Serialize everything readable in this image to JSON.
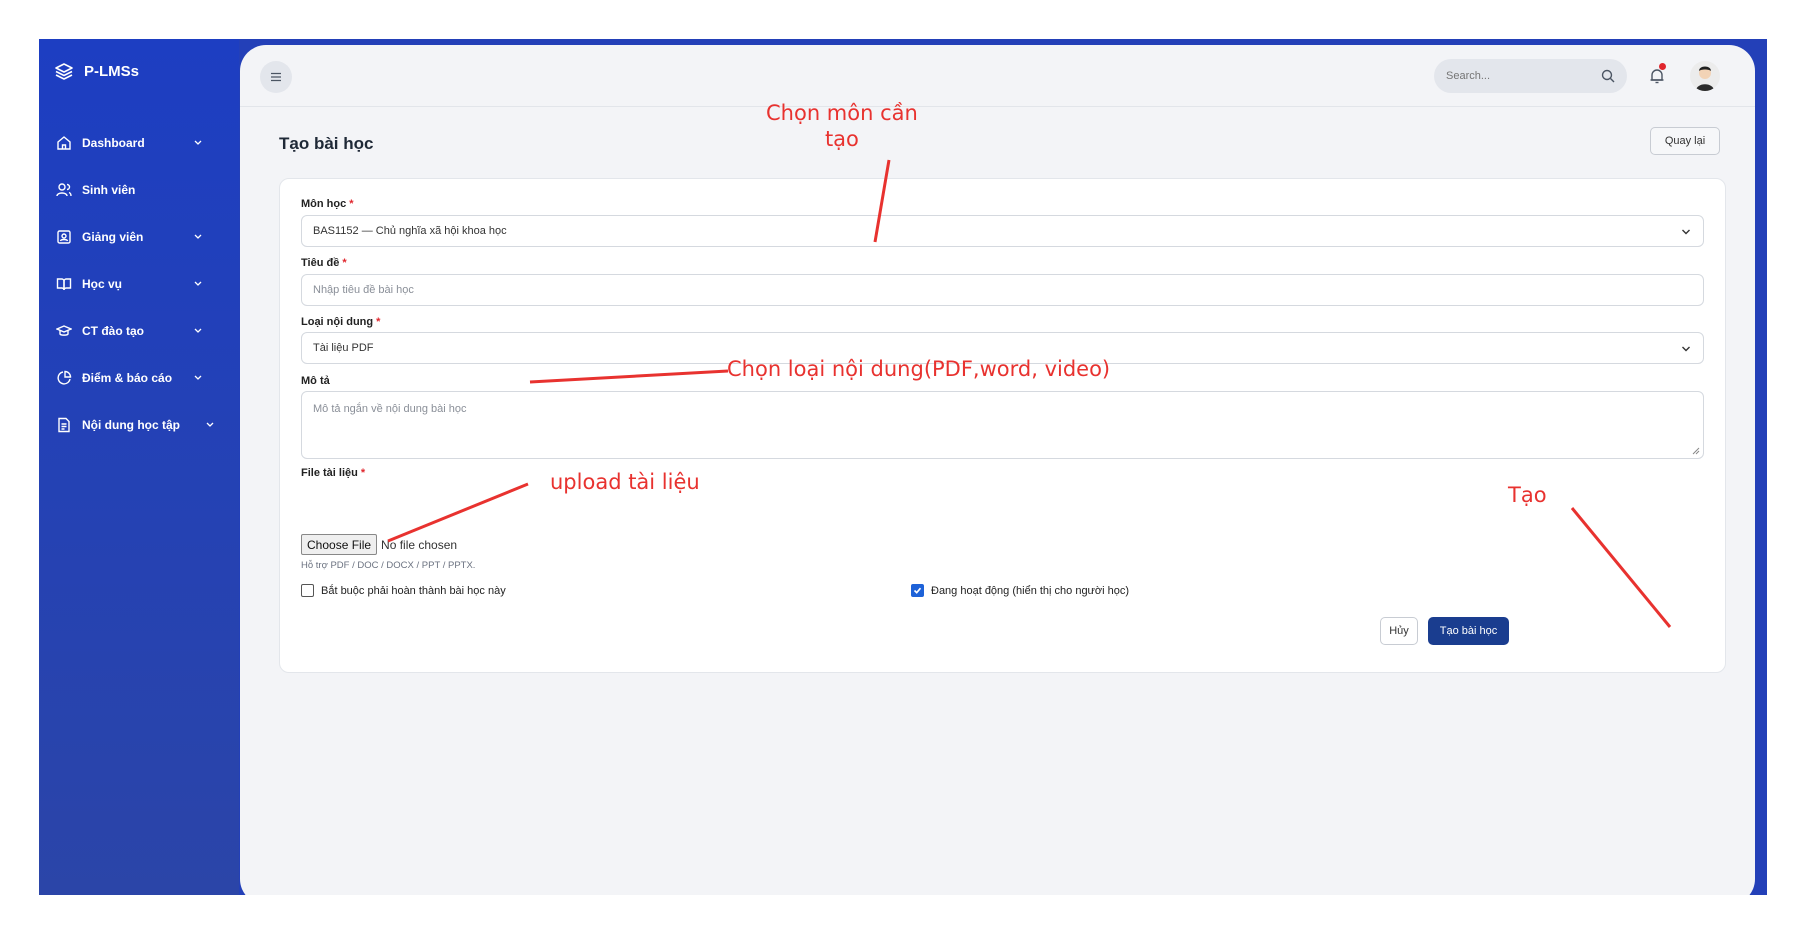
{
  "app": {
    "brand": "P-LMSs"
  },
  "sidebar": {
    "items": [
      {
        "label": "Dashboard",
        "icon": "home-icon",
        "has_chevron": true
      },
      {
        "label": "Sinh viên",
        "icon": "users-icon",
        "has_chevron": false
      },
      {
        "label": "Giảng viên",
        "icon": "id-card-icon",
        "has_chevron": true
      },
      {
        "label": "Học vụ",
        "icon": "book-icon",
        "has_chevron": true
      },
      {
        "label": "CT đào tạo",
        "icon": "graduation-cap-icon",
        "has_chevron": true
      },
      {
        "label": "Điểm & báo cáo",
        "icon": "pie-chart-icon",
        "has_chevron": true
      },
      {
        "label": "Nội dung học tập",
        "icon": "document-icon",
        "has_chevron": true
      }
    ]
  },
  "topbar": {
    "search_placeholder": "Search..."
  },
  "page": {
    "title": "Tạo bài học",
    "back_label": "Quay lại"
  },
  "form": {
    "subject": {
      "label": "Môn học",
      "required": "*",
      "value": "BAS1152 — Chủ nghĩa xã hội khoa học"
    },
    "title": {
      "label": "Tiêu đề",
      "required": "*",
      "placeholder": "Nhập tiêu đề bài học"
    },
    "content_type": {
      "label": "Loại nội dung",
      "required": "*",
      "value": "Tài liệu PDF"
    },
    "description": {
      "label": "Mô tả",
      "placeholder": "Mô tả ngắn về nội dung bài học"
    },
    "file": {
      "label": "File tài liệu",
      "required": "*",
      "button": "Choose File",
      "status": "No file chosen",
      "hint": "Hỗ trợ PDF / DOC / DOCX / PPT / PPTX."
    },
    "required_checkbox": {
      "label": "Bắt buộc phải hoàn thành bài học này",
      "checked": false
    },
    "active_checkbox": {
      "label": "Đang hoạt động (hiển thị cho người học)",
      "checked": true
    },
    "cancel_label": "Hủy",
    "submit_label": "Tạo bài học"
  },
  "annotations": {
    "subject_line1": "Chọn môn cần",
    "subject_line2": "tạo",
    "content_type": "Chọn loại nội dung(PDF,word, video)",
    "upload": "upload tài liệu",
    "create": "Tạo"
  },
  "colors": {
    "sidebar": "#1d3ec2",
    "accent": "#1a3d8f",
    "annotation": "#e8322f",
    "required": "#e0262d"
  }
}
